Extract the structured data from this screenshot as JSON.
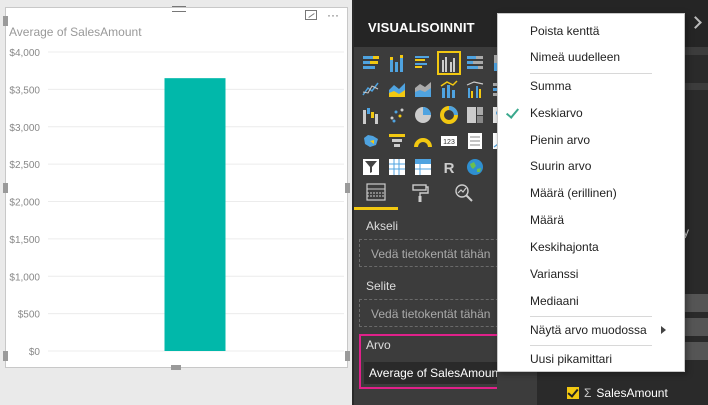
{
  "chart_data": {
    "type": "bar",
    "title": "Average of SalesAmount",
    "categories": [
      ""
    ],
    "values": [
      3650
    ],
    "ylim": [
      0,
      4000
    ],
    "yticks": [
      "$4,000",
      "$3,500",
      "$3,000",
      "$2,500",
      "$2,000",
      "$1,500",
      "$1,000",
      "$500",
      "$0"
    ],
    "grid": true,
    "legend": "none",
    "bar_color": "#01b8aa"
  },
  "visual": {
    "more_options": "···"
  },
  "panel": {
    "title": "VISUALISOINNIT",
    "tabs": [
      "fields-tab",
      "format-tab",
      "analytics-tab"
    ],
    "axis_label": "Akseli",
    "axis_placeholder": "Vedä tietokentät tähän",
    "legend_label": "Selite",
    "legend_placeholder": "Vedä tietokentät tähän",
    "value_label": "Arvo",
    "value_field": "Average of SalesAmount"
  },
  "fields": {
    "visible_text": "y",
    "sales_field": "SalesAmount"
  },
  "menu": {
    "items": [
      {
        "label": "Poista kenttä"
      },
      {
        "label": "Nimeä uudelleen"
      },
      {
        "label": "Summa"
      },
      {
        "label": "Keskiarvo",
        "checked": true
      },
      {
        "label": "Pienin arvo"
      },
      {
        "label": "Suurin arvo"
      },
      {
        "label": "Määrä (erillinen)"
      },
      {
        "label": "Määrä"
      },
      {
        "label": "Keskihajonta"
      },
      {
        "label": "Varianssi"
      },
      {
        "label": "Mediaani"
      },
      {
        "label": "Näytä arvo muodossa",
        "submenu": true
      },
      {
        "label": "Uusi pikamittari"
      }
    ]
  },
  "colors": {
    "accent": "#f2c811",
    "highlight": "#e0218a",
    "check": "#3aa88d",
    "bar": "#01b8aa"
  }
}
